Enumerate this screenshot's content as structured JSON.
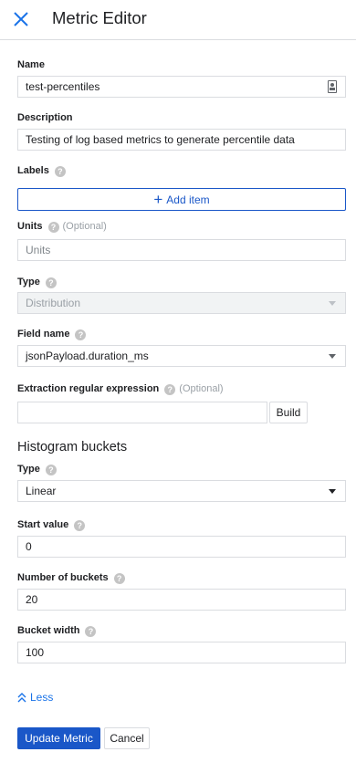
{
  "header": {
    "title": "Metric Editor",
    "close_icon": "close-icon"
  },
  "name": {
    "label": "Name",
    "value": "test-percentiles"
  },
  "description": {
    "label": "Description",
    "value": "Testing of log based metrics to generate percentile data"
  },
  "labels": {
    "label": "Labels",
    "add_item": "Add item"
  },
  "units": {
    "label": "Units",
    "optional": "(Optional)",
    "placeholder": "Units"
  },
  "type": {
    "label": "Type",
    "value": "Distribution"
  },
  "field_name": {
    "label": "Field name",
    "value": "jsonPayload.duration_ms"
  },
  "extraction": {
    "label": "Extraction regular expression",
    "optional": "(Optional)",
    "value": "",
    "build": "Build"
  },
  "histogram": {
    "title": "Histogram buckets",
    "type_label": "Type",
    "type_value": "Linear",
    "start_label": "Start value",
    "start_value": "0",
    "num_label": "Number of buckets",
    "num_value": "20",
    "width_label": "Bucket width",
    "width_value": "100"
  },
  "toggle": {
    "less": "Less"
  },
  "actions": {
    "update": "Update Metric",
    "cancel": "Cancel"
  },
  "colors": {
    "accent": "#1a57c8",
    "link": "#1a73e8",
    "border": "#dadce0"
  }
}
